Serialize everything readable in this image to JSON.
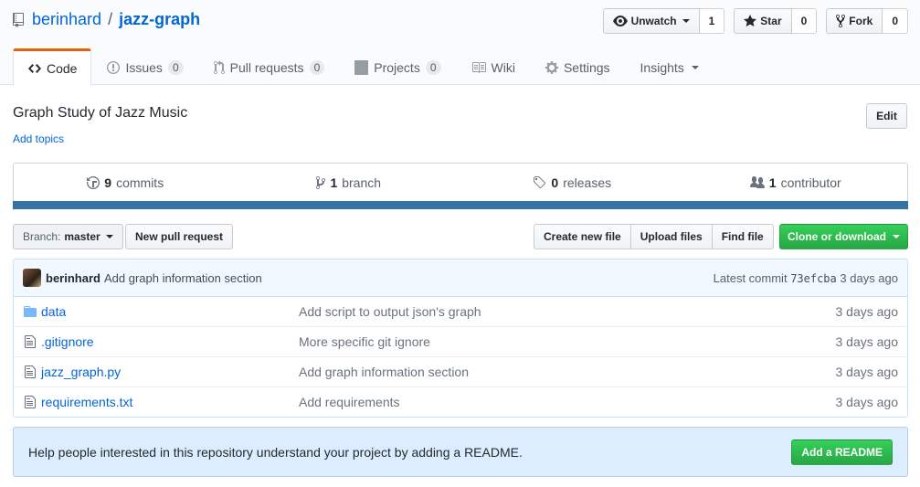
{
  "repo": {
    "owner": "berinhard",
    "separator": "/",
    "name": "jazz-graph"
  },
  "actions": {
    "watch": {
      "label": "Unwatch",
      "count": "1"
    },
    "star": {
      "label": "Star",
      "count": "0"
    },
    "fork": {
      "label": "Fork",
      "count": "0"
    }
  },
  "tabs": [
    {
      "label": "Code",
      "icon": "code-icon"
    },
    {
      "label": "Issues",
      "count": "0",
      "icon": "issue-icon"
    },
    {
      "label": "Pull requests",
      "count": "0",
      "icon": "pull-request-icon"
    },
    {
      "label": "Projects",
      "count": "0",
      "icon": "project-icon"
    },
    {
      "label": "Wiki",
      "icon": "book-icon"
    },
    {
      "label": "Settings",
      "icon": "gear-icon"
    },
    {
      "label": "Insights",
      "icon": "caret-down-icon"
    }
  ],
  "description": "Graph Study of Jazz Music",
  "add_topics": "Add topics",
  "edit_label": "Edit",
  "summary": {
    "commits": {
      "num": "9",
      "label": "commits"
    },
    "branches": {
      "num": "1",
      "label": "branch"
    },
    "releases": {
      "num": "0",
      "label": "releases"
    },
    "contributors": {
      "num": "1",
      "label": "contributor"
    }
  },
  "language_color": "#3572A5",
  "branch": {
    "prefix": "Branch:",
    "name": "master"
  },
  "new_pull_request": "New pull request",
  "file_actions": [
    "Create new file",
    "Upload files",
    "Find file"
  ],
  "clone_label": "Clone or download",
  "commit": {
    "author": "berinhard",
    "message": "Add graph information section",
    "latest_label": "Latest commit",
    "sha": "73efcba",
    "age": "3 days ago"
  },
  "files": [
    {
      "type": "dir",
      "name": "data",
      "message": "Add script to output json's graph",
      "age": "3 days ago"
    },
    {
      "type": "file",
      "name": ".gitignore",
      "message": "More specific git ignore",
      "age": "3 days ago"
    },
    {
      "type": "file",
      "name": "jazz_graph.py",
      "message": "Add graph information section",
      "age": "3 days ago"
    },
    {
      "type": "file",
      "name": "requirements.txt",
      "message": "Add requirements",
      "age": "3 days ago"
    }
  ],
  "readme_prompt": {
    "text": "Help people interested in this repository understand your project by adding a README.",
    "button": "Add a README"
  }
}
